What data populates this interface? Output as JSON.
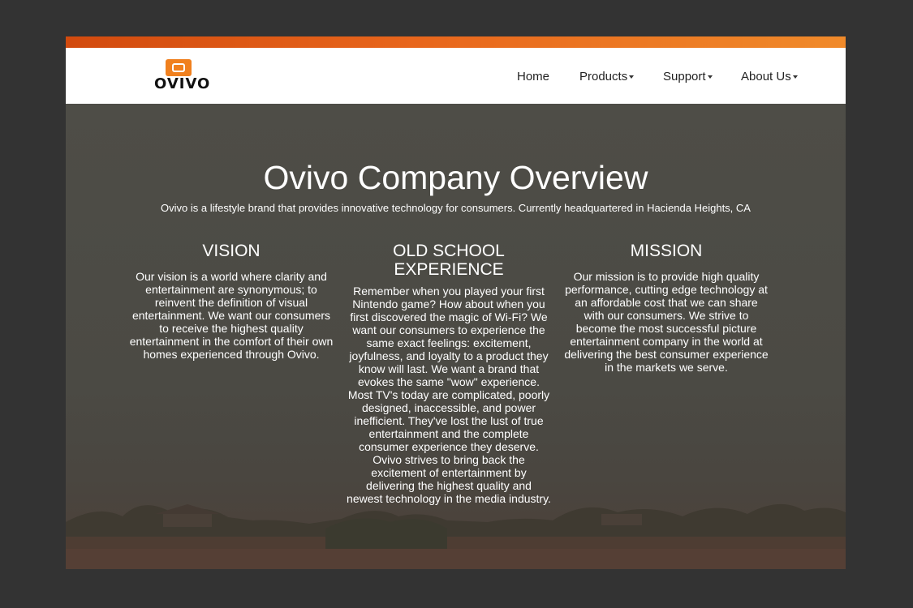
{
  "brand": {
    "logo_text": "OVIVO"
  },
  "nav": {
    "items": [
      {
        "label": "Home",
        "has_dropdown": false
      },
      {
        "label": "Products",
        "has_dropdown": true
      },
      {
        "label": "Support",
        "has_dropdown": true
      },
      {
        "label": "About Us",
        "has_dropdown": true
      }
    ]
  },
  "hero": {
    "title": "Ovivo Company Overview",
    "subtitle": "Ovivo is a lifestyle brand that provides innovative technology for consumers. Currently headquartered in Hacienda Heights, CA"
  },
  "columns": [
    {
      "heading": "VISION",
      "body": "Our vision is a world where clarity and entertainment are synonymous; to reinvent the definition of visual entertainment. We want our consumers to receive the highest quality entertainment in the comfort of their own homes experienced through Ovivo."
    },
    {
      "heading": "OLD SCHOOL EXPERIENCE",
      "body": "Remember when you played your first Nintendo game? How about when you first discovered the magic of Wi-Fi? We want our consumers to experience the same exact feelings: excitement, joyfulness, and loyalty to a product they know will last. We want a brand that evokes the same \"wow\" experience. Most TV's today are complicated, poorly designed, inaccessible, and power inefficient. They've lost the lust of true entertainment and the complete consumer experience they deserve. Ovivo strives to bring back the excitement of entertainment by delivering the highest quality and newest technology in the media industry."
    },
    {
      "heading": "MISSION",
      "body": "Our mission is to provide high quality performance, cutting edge technology at an affordable cost that we can share with our consumers. We strive to become the most successful picture entertainment company in the world at delivering the best consumer experience in the markets we serve."
    }
  ],
  "colors": {
    "accent": "#f0801e",
    "topbar_start": "#d24a0e",
    "topbar_end": "#f08a2a",
    "hero_overlay": "#4a4a44",
    "outer_background": "#333333"
  },
  "icons": {
    "dropdown": "caret-down-icon",
    "logo": "ovivo-logo-icon"
  }
}
